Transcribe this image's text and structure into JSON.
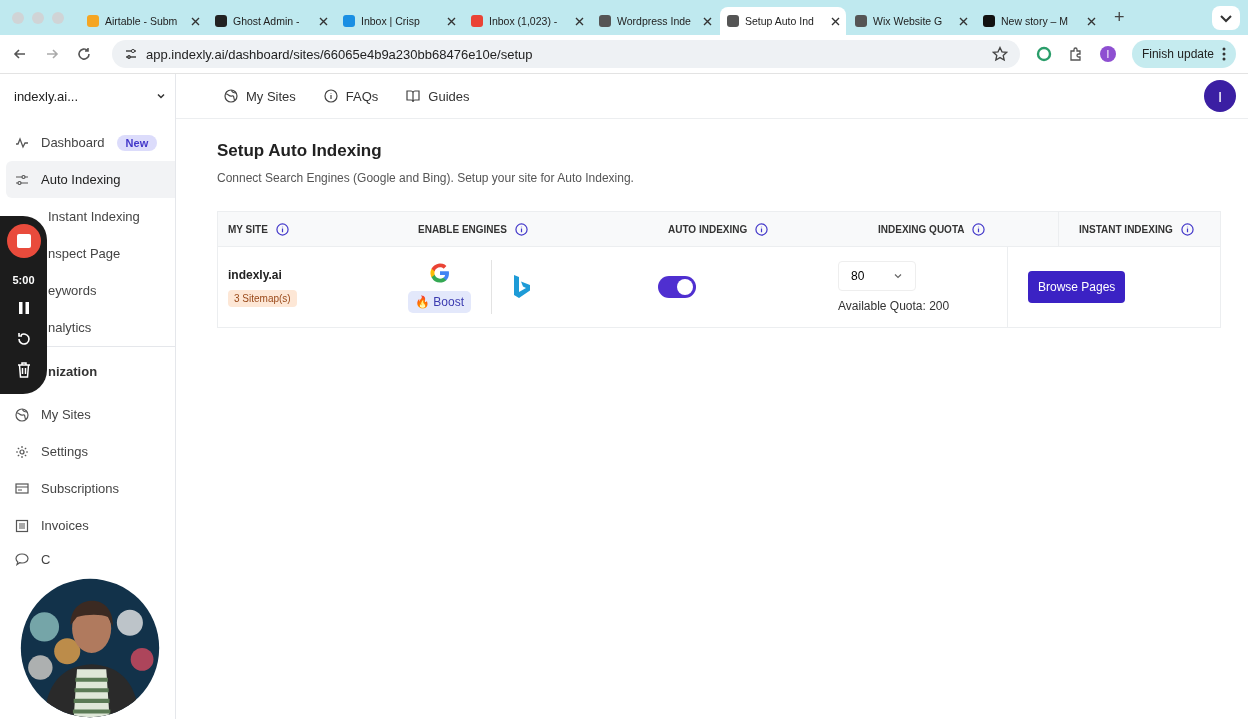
{
  "browser": {
    "tabs": [
      {
        "label": "Airtable - Subm",
        "selected": false
      },
      {
        "label": "Ghost Admin -",
        "selected": false
      },
      {
        "label": "Inbox | Crisp",
        "selected": false
      },
      {
        "label": "Inbox (1,023) -",
        "selected": false
      },
      {
        "label": "Wordpress Inde",
        "selected": false
      },
      {
        "label": "Setup Auto Ind",
        "selected": true
      },
      {
        "label": "Wix Website G",
        "selected": false
      },
      {
        "label": "New story – M",
        "selected": false
      }
    ],
    "tab_new": "+",
    "address": "app.indexly.ai/dashboard/sites/66065e4b9a230bb68476e10e/setup",
    "profile": "I",
    "update_button": "Finish update"
  },
  "sidebar": {
    "site": "indexly.ai...",
    "items": [
      {
        "label": "Dashboard",
        "kind": "normal",
        "selected": false,
        "badge": "New"
      },
      {
        "label": "Auto Indexing",
        "kind": "normal",
        "selected": true
      },
      {
        "label": "Instant Indexing",
        "kind": "covered",
        "selected": false
      },
      {
        "label": "nspect Page",
        "kind": "covered",
        "selected": false
      },
      {
        "label": "eywords",
        "kind": "covered",
        "selected": false
      },
      {
        "label": "nalytics",
        "kind": "covered",
        "selected": false
      },
      {
        "label": "nization",
        "kind": "heading",
        "selected": false
      },
      {
        "label": "My Sites",
        "kind": "normal",
        "selected": false
      },
      {
        "label": "Settings",
        "kind": "normal",
        "selected": false
      },
      {
        "label": "Subscriptions",
        "kind": "normal",
        "selected": false
      },
      {
        "label": "Invoices",
        "kind": "normal",
        "selected": false
      },
      {
        "label": "C",
        "kind": "normal",
        "selected": false
      }
    ]
  },
  "topnav": [
    {
      "label": "My Sites"
    },
    {
      "label": "FAQs"
    },
    {
      "label": "Guides"
    }
  ],
  "user_avatar": "I",
  "page": {
    "title": "Setup Auto Indexing",
    "subtitle": "Connect Search Engines (Google and Bing). Setup your site for Auto Indexing."
  },
  "table": {
    "columns": [
      "MY SITE",
      "ENABLE ENGINES",
      "AUTO INDEXING",
      "INDEXING QUOTA",
      "INSTANT INDEXING"
    ],
    "rows": [
      {
        "site": "indexly.ai",
        "sitemaps": "3 Sitemap(s)",
        "boost": "🔥 Boost",
        "auto_indexing": true,
        "quota": "80",
        "available": "Available Quota: 200",
        "action": "Browse Pages"
      }
    ]
  },
  "recorder": {
    "time": "5:00"
  }
}
